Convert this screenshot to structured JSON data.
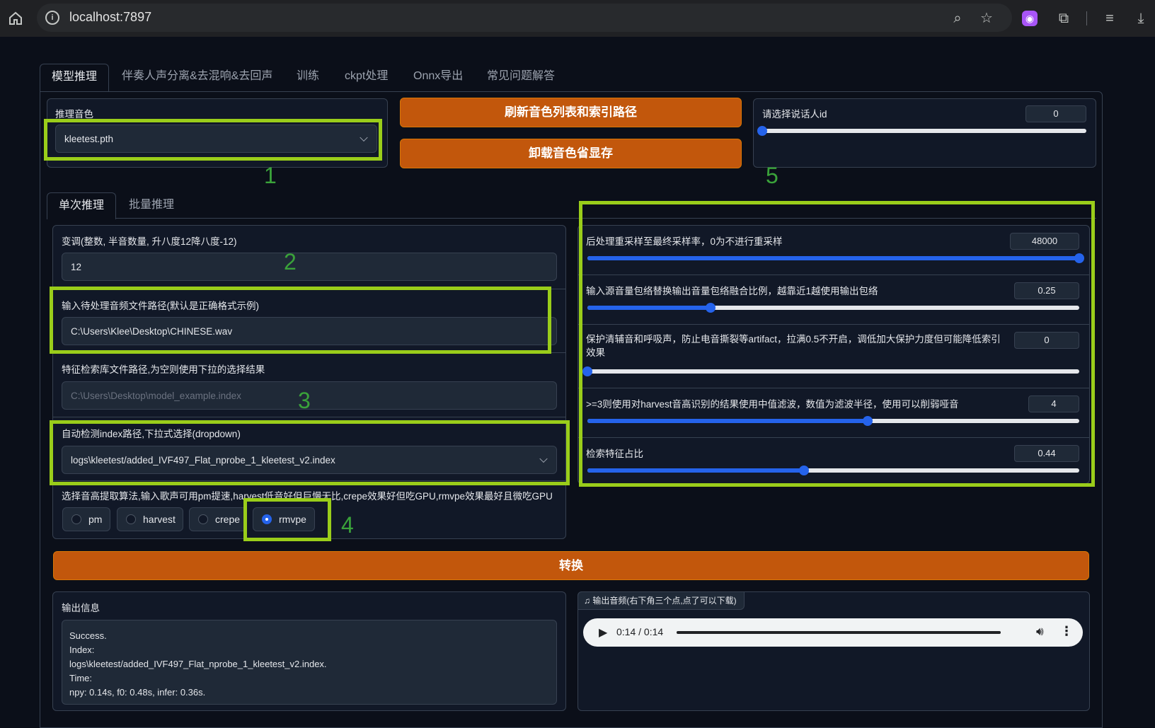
{
  "browser": {
    "url": "localhost:7897"
  },
  "tabs": [
    "模型推理",
    "伴奏人声分离&去混响&去回声",
    "训练",
    "ckpt处理",
    "Onnx导出",
    "常见问题解答"
  ],
  "voice": {
    "label": "推理音色",
    "value": "kleetest.pth"
  },
  "buttons": {
    "refresh": "刷新音色列表和索引路径",
    "unload": "卸载音色省显存",
    "convert": "转换"
  },
  "speaker": {
    "label": "请选择说话人id",
    "value": "0",
    "fraction": 0.0
  },
  "subtabs": [
    "单次推理",
    "批量推理"
  ],
  "transpose": {
    "label": "变调(整数, 半音数量, 升八度12降八度-12)",
    "value": "12"
  },
  "input_path": {
    "label": "输入待处理音频文件路径(默认是正确格式示例)",
    "value": "C:\\Users\\Klee\\Desktop\\CHINESE.wav"
  },
  "index_path": {
    "label": "特征检索库文件路径,为空则使用下拉的选择结果",
    "placeholder": "C:\\Users\\Desktop\\model_example.index"
  },
  "index_dropdown": {
    "label": "自动检测index路径,下拉式选择(dropdown)",
    "value": "logs\\kleetest/added_IVF497_Flat_nprobe_1_kleetest_v2.index"
  },
  "f0": {
    "label": "选择音高提取算法,输入歌声可用pm提速,harvest低音好但巨慢无比,crepe效果好但吃GPU,rmvpe效果最好且微吃GPU",
    "options": [
      "pm",
      "harvest",
      "crepe",
      "rmvpe"
    ],
    "selected": "rmvpe"
  },
  "sliders": {
    "resample": {
      "label": "后处理重采样至最终采样率，0为不进行重采样",
      "value": "48000",
      "fraction": 1.0
    },
    "rms_mix": {
      "label": "输入源音量包络替换输出音量包络融合比例，越靠近1越使用输出包络",
      "value": "0.25",
      "fraction": 0.25
    },
    "protect": {
      "label": "保护清辅音和呼吸声，防止电音撕裂等artifact，拉满0.5不开启，调低加大保护力度但可能降低索引效果",
      "value": "0",
      "fraction": 0.0
    },
    "filter_radius": {
      "label": ">=3则使用对harvest音高识别的结果使用中值滤波，数值为滤波半径，使用可以削弱哑音",
      "value": "4",
      "fraction": 0.57
    },
    "index_rate": {
      "label": "检索特征占比",
      "value": "0.44",
      "fraction": 0.44
    }
  },
  "output": {
    "label": "输出信息",
    "lines": [
      "Success.",
      "Index:",
      "logs\\kleetest/added_IVF497_Flat_nprobe_1_kleetest_v2.index.",
      "Time:",
      "npy: 0.14s, f0: 0.48s, infer: 0.36s."
    ]
  },
  "audio": {
    "label": "输出音频(右下角三个点,点了可以下载)",
    "time": "0:14 / 0:14",
    "progress": 1.0
  },
  "annotations": [
    "1",
    "2",
    "3",
    "4",
    "5"
  ],
  "colors": {
    "accent": "#c2570c",
    "slider": "#2563eb",
    "highlight": "#9acd1a"
  }
}
